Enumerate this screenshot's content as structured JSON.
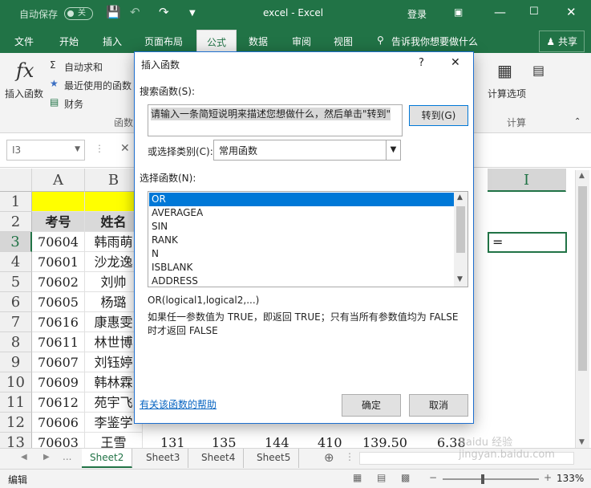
{
  "titlebar": {
    "autosave_label": "自动保存",
    "autosave_state": "关",
    "app_title": "excel  -  Excel",
    "login_label": "登录"
  },
  "tabs": [
    "文件",
    "开始",
    "插入",
    "页面布局",
    "公式",
    "数据",
    "审阅",
    "视图"
  ],
  "active_tab": "公式",
  "tell_me": "告诉我你想要做什么",
  "share": "共享",
  "ribbon": {
    "insert_function": "插入函数",
    "autosum": "自动求和",
    "recent": "最近使用的函数",
    "finance": "财务",
    "group_function_library": "函数",
    "calc_options": "计算选项",
    "group_calc": "计算"
  },
  "namebox": "I3",
  "columns": [
    "A",
    "B",
    "I"
  ],
  "rows": [
    {
      "num": "1",
      "a": "",
      "b": ""
    },
    {
      "num": "2",
      "a": "考号",
      "b": "姓名"
    },
    {
      "num": "3",
      "a": "70604",
      "b": "韩雨萌"
    },
    {
      "num": "4",
      "a": "70601",
      "b": "沙龙逸"
    },
    {
      "num": "5",
      "a": "70602",
      "b": "刘帅"
    },
    {
      "num": "6",
      "a": "70605",
      "b": "杨璐"
    },
    {
      "num": "7",
      "a": "70616",
      "b": "康惠雯"
    },
    {
      "num": "8",
      "a": "70611",
      "b": "林世博"
    },
    {
      "num": "9",
      "a": "70607",
      "b": "刘钰婷"
    },
    {
      "num": "10",
      "a": "70609",
      "b": "韩林霖"
    },
    {
      "num": "11",
      "a": "70612",
      "b": "苑宇飞"
    },
    {
      "num": "12",
      "a": "70606",
      "b": "李鉴学"
    },
    {
      "num": "13",
      "a": "70603",
      "b": "王雪"
    }
  ],
  "row13_values": [
    "131",
    "135",
    "144",
    "410",
    "139.50",
    "6.38"
  ],
  "active_cell_value": "=",
  "sheets": [
    "Sheet2",
    "Sheet3",
    "Sheet4",
    "Sheet5"
  ],
  "active_sheet": "Sheet2",
  "status": {
    "mode": "编辑",
    "zoom": "133%"
  },
  "dialog": {
    "title": "插入函数",
    "help_glyph": "?",
    "close_glyph": "✕",
    "search_label": "搜索函数(S):",
    "search_value": "请输入一条简短说明来描述您想做什么，然后单击\"转到\"",
    "go_button": "转到(G)",
    "category_label": "或选择类别(C):",
    "category_value": "常用函数",
    "select_label": "选择函数(N):",
    "functions": [
      "OR",
      "AVERAGEA",
      "SIN",
      "RANK",
      "N",
      "ISBLANK",
      "ADDRESS"
    ],
    "selected_function": "OR",
    "signature": "OR(logical1,logical2,...)",
    "description": "如果任一参数值为 TRUE，即返回 TRUE；只有当所有参数值均为 FALSE 时才返回 FALSE",
    "help_link": "有关该函数的帮助",
    "ok_button": "确定",
    "cancel_button": "取消"
  },
  "watermark": "Baidu 经验 jingyan.baidu.com"
}
